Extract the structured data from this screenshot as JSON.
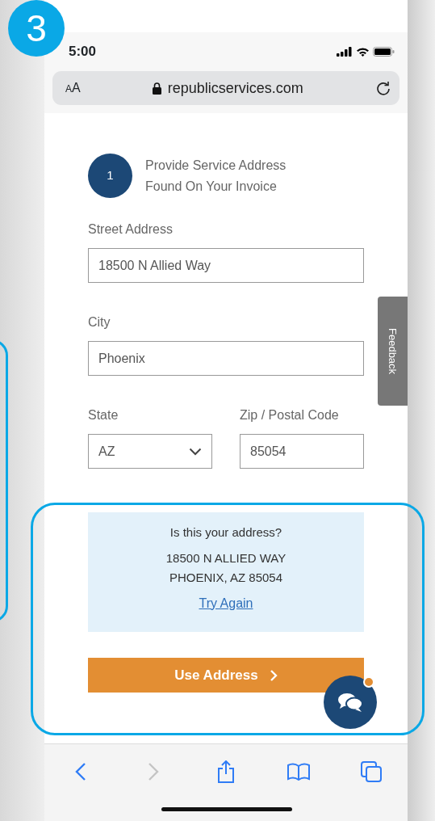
{
  "step_badge": "3",
  "status_bar": {
    "time": "5:00"
  },
  "address_bar": {
    "text_size_button": "AA",
    "url": "republicservices.com"
  },
  "form": {
    "step": {
      "number": "1",
      "title": "Provide Service Address Found On Your Invoice"
    },
    "fields": [
      {
        "kind": "text",
        "label": "Street Address",
        "value": "18500 N Allied Way"
      },
      {
        "kind": "text",
        "label": "City",
        "value": "Phoenix"
      }
    ],
    "field_row": [
      {
        "kind": "select",
        "label": "State",
        "value": "AZ"
      },
      {
        "kind": "text",
        "label": "Zip / Postal Code",
        "value": "85054"
      }
    ]
  },
  "confirmation": {
    "question": "Is this your address?",
    "address_lines": [
      "18500 N ALLIED WAY",
      "PHOENIX, AZ 85054"
    ],
    "link": "Try Again"
  },
  "primary_button": "Use Address",
  "feedback_tab": "Feedback",
  "chat": {
    "notification": true
  },
  "toolbar": {
    "back_disabled": false,
    "forward_disabled": true
  }
}
